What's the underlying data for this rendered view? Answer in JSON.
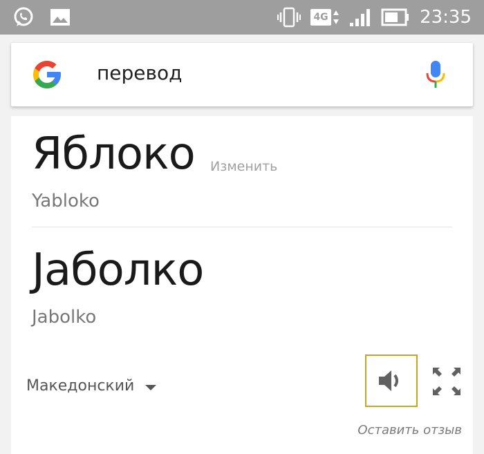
{
  "status_bar": {
    "time": "23:35",
    "network": "4G",
    "left_icons": [
      "whatsapp-icon",
      "gallery-icon"
    ],
    "right_icons": [
      "vibrate-icon",
      "network-4g-icon",
      "signal-icon",
      "battery-icon"
    ]
  },
  "search": {
    "query": "перевод",
    "icons": [
      "google-logo-icon",
      "mic-icon"
    ]
  },
  "translation": {
    "source_word": "Яблоко",
    "change_label": "Изменить",
    "source_transliteration": "Yabloko",
    "target_word": "Јаболко",
    "target_transliteration": "Jabolko",
    "target_language": "Македонский",
    "feedback_label": "Оставить отзыв",
    "icons": [
      "speaker-icon",
      "expand-icon",
      "dropdown-caret-icon"
    ]
  },
  "colors": {
    "status_bar": "#9e9e9e",
    "speaker_border": "#c9a227",
    "google_blue": "#4285F4",
    "google_red": "#EA4335",
    "google_yellow": "#FBBC05",
    "google_green": "#34A853"
  }
}
